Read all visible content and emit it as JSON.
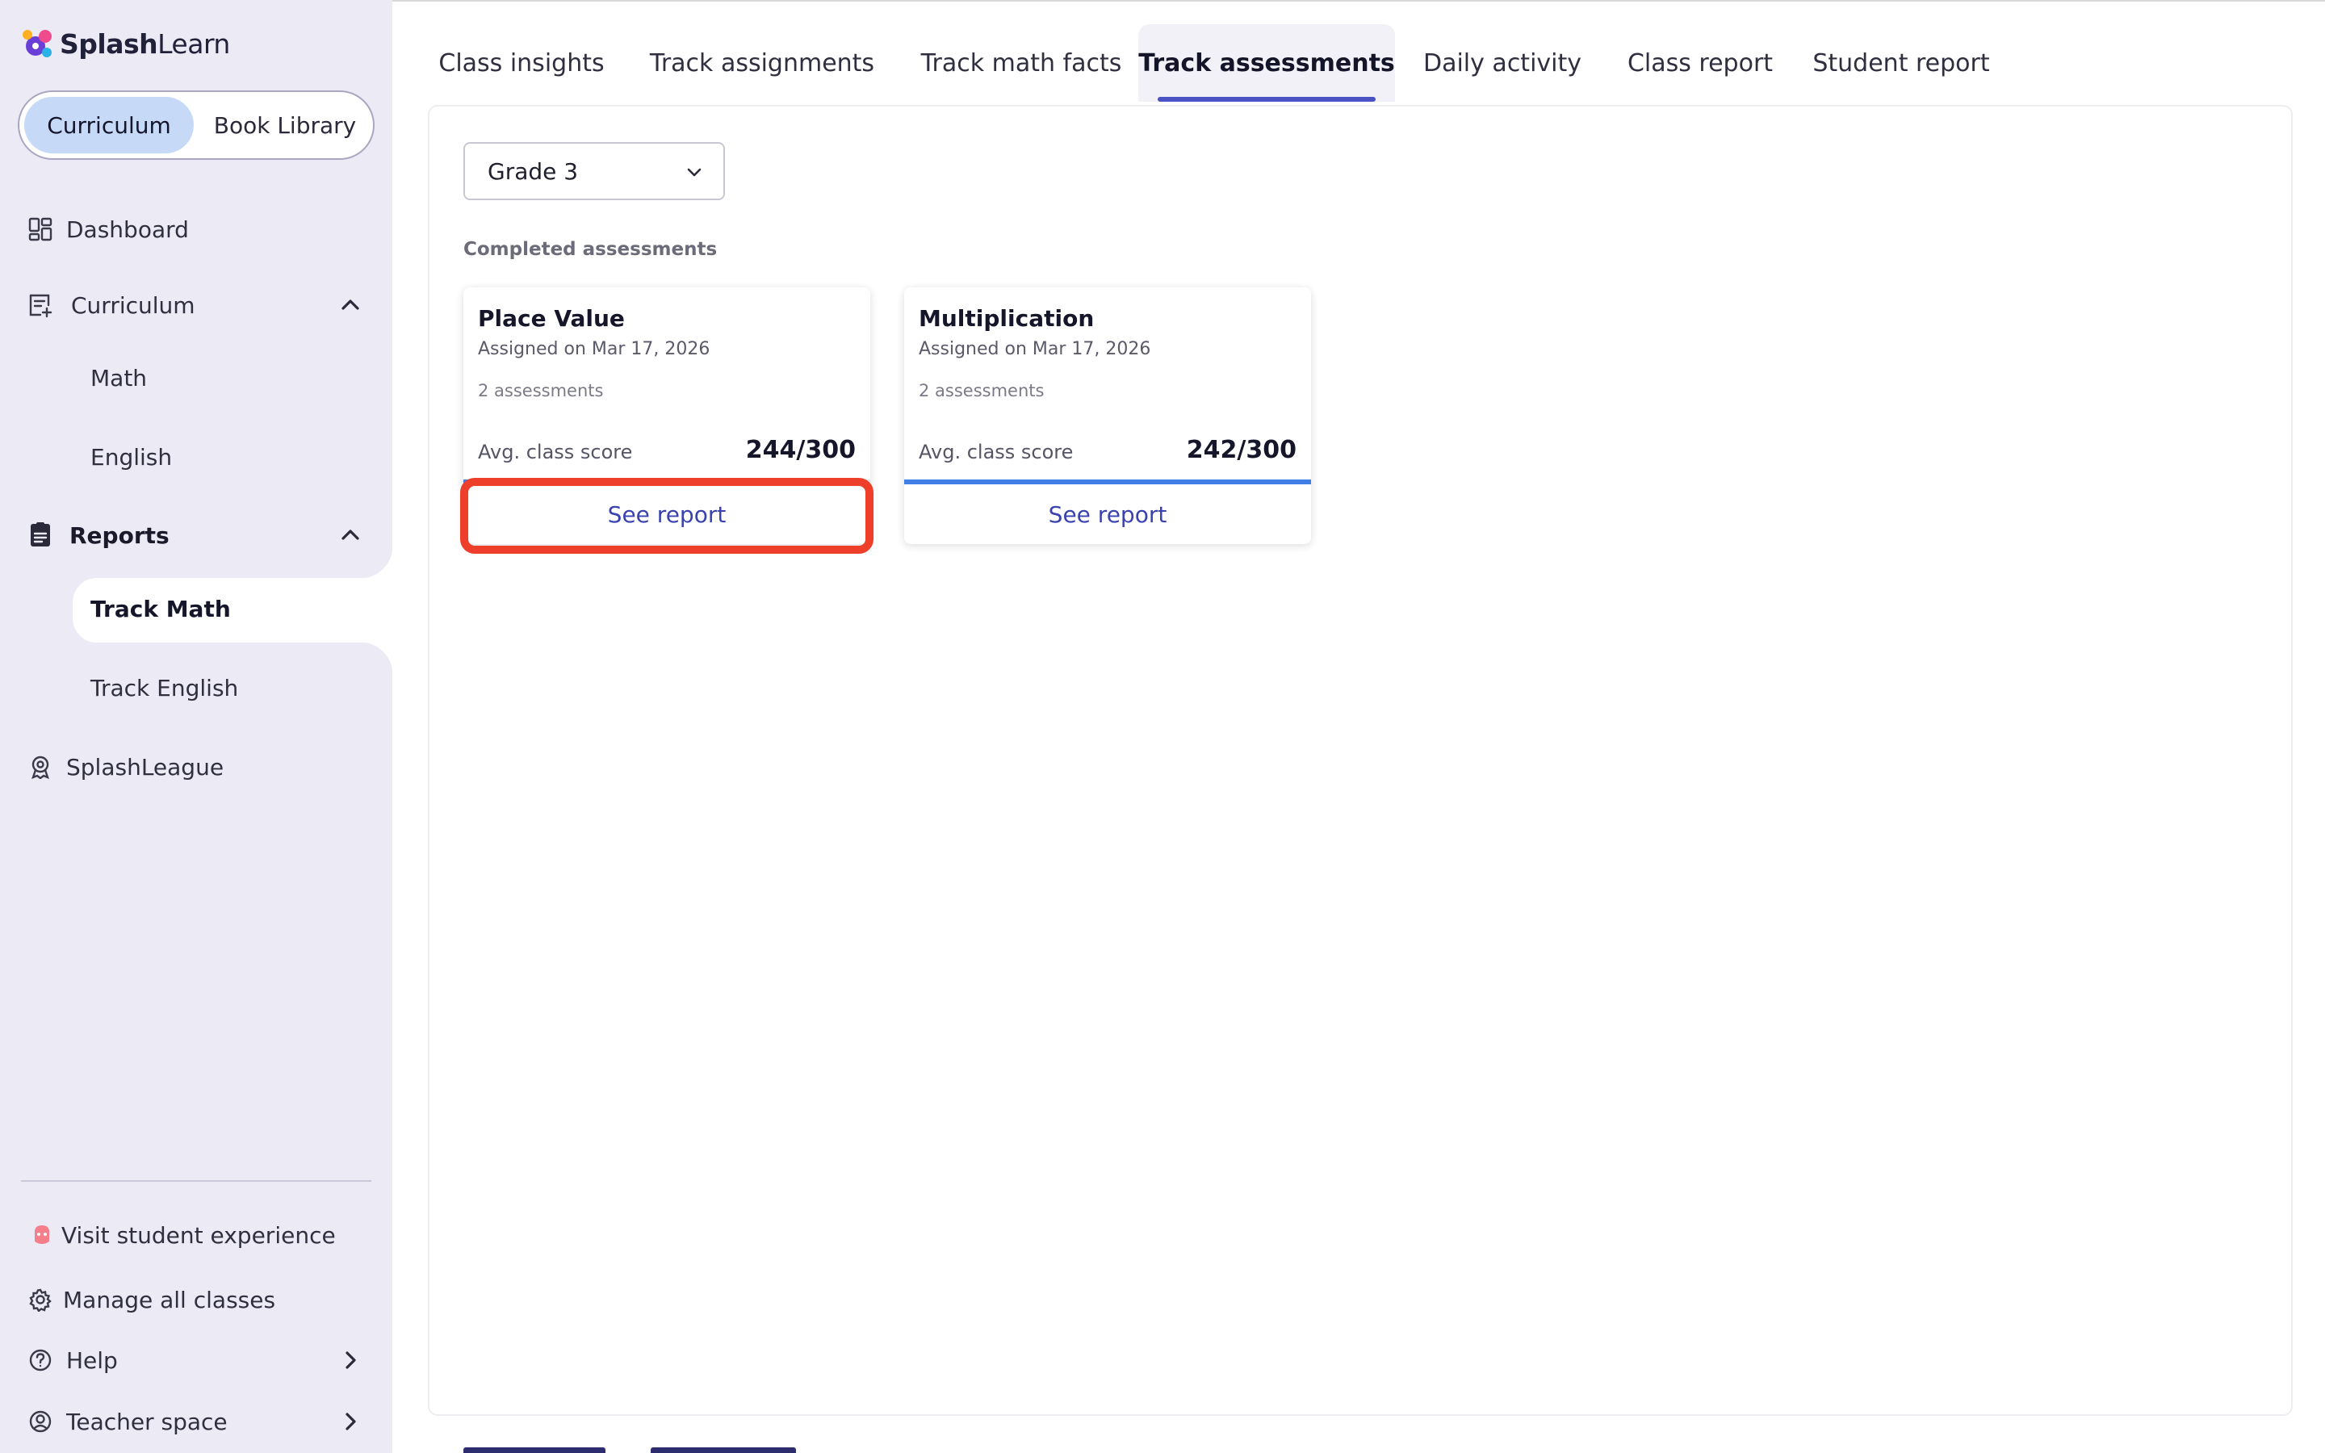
{
  "brand": {
    "name_bold": "Splash",
    "name_regular": "Learn",
    "logo_icon": "splashlearn-logo-icon"
  },
  "sidebar": {
    "switch": {
      "active_label": "Curriculum",
      "other_label": "Book Library"
    },
    "items": {
      "dashboard": {
        "label": "Dashboard",
        "icon": "dashboard-icon"
      },
      "curriculum": {
        "label": "Curriculum",
        "icon": "curriculum-icon",
        "expanded": true
      },
      "math": {
        "label": "Math"
      },
      "english": {
        "label": "English"
      },
      "reports": {
        "label": "Reports",
        "icon": "reports-icon",
        "expanded": true
      },
      "track_math": {
        "label": "Track Math",
        "selected": true
      },
      "track_english": {
        "label": "Track English"
      },
      "splashleague": {
        "label": "SplashLeague",
        "icon": "splashleague-icon"
      }
    },
    "footer": {
      "visit_student": {
        "label": "Visit student experience",
        "icon": "student-icon"
      },
      "manage_classes": {
        "label": "Manage all classes",
        "icon": "gear-icon"
      },
      "help": {
        "label": "Help",
        "icon": "help-icon"
      },
      "teacher_space": {
        "label": "Teacher space",
        "icon": "user-circle-icon"
      }
    }
  },
  "tabs": [
    {
      "label": "Class insights",
      "active": false
    },
    {
      "label": "Track assignments",
      "active": false
    },
    {
      "label": "Track math facts",
      "active": false
    },
    {
      "label": "Track assessments",
      "active": true
    },
    {
      "label": "Daily activity",
      "active": false
    },
    {
      "label": "Class report",
      "active": false
    },
    {
      "label": "Student report",
      "active": false
    }
  ],
  "main": {
    "grade_select": {
      "value": "Grade 3"
    },
    "section_label": "Completed assessments",
    "cards": [
      {
        "title": "Place Value",
        "assigned": "Assigned on Mar 17, 2026",
        "count": "2 assessments",
        "score_label": "Avg. class score",
        "score": "244/300",
        "button": "See report",
        "progress_fraction": 0.02
      },
      {
        "title": "Multiplication",
        "assigned": "Assigned on Mar 17, 2026",
        "count": "2 assessments",
        "score_label": "Avg. class score",
        "score": "242/300",
        "button": "See report",
        "progress_fraction": 1.0
      }
    ]
  },
  "colors": {
    "accent": "#4a52c4",
    "progress": "#3f7fe6",
    "highlight": "#ee3f2b",
    "sidebar_bg": "#ebeaf5",
    "switch_active": "#c6daf8"
  }
}
